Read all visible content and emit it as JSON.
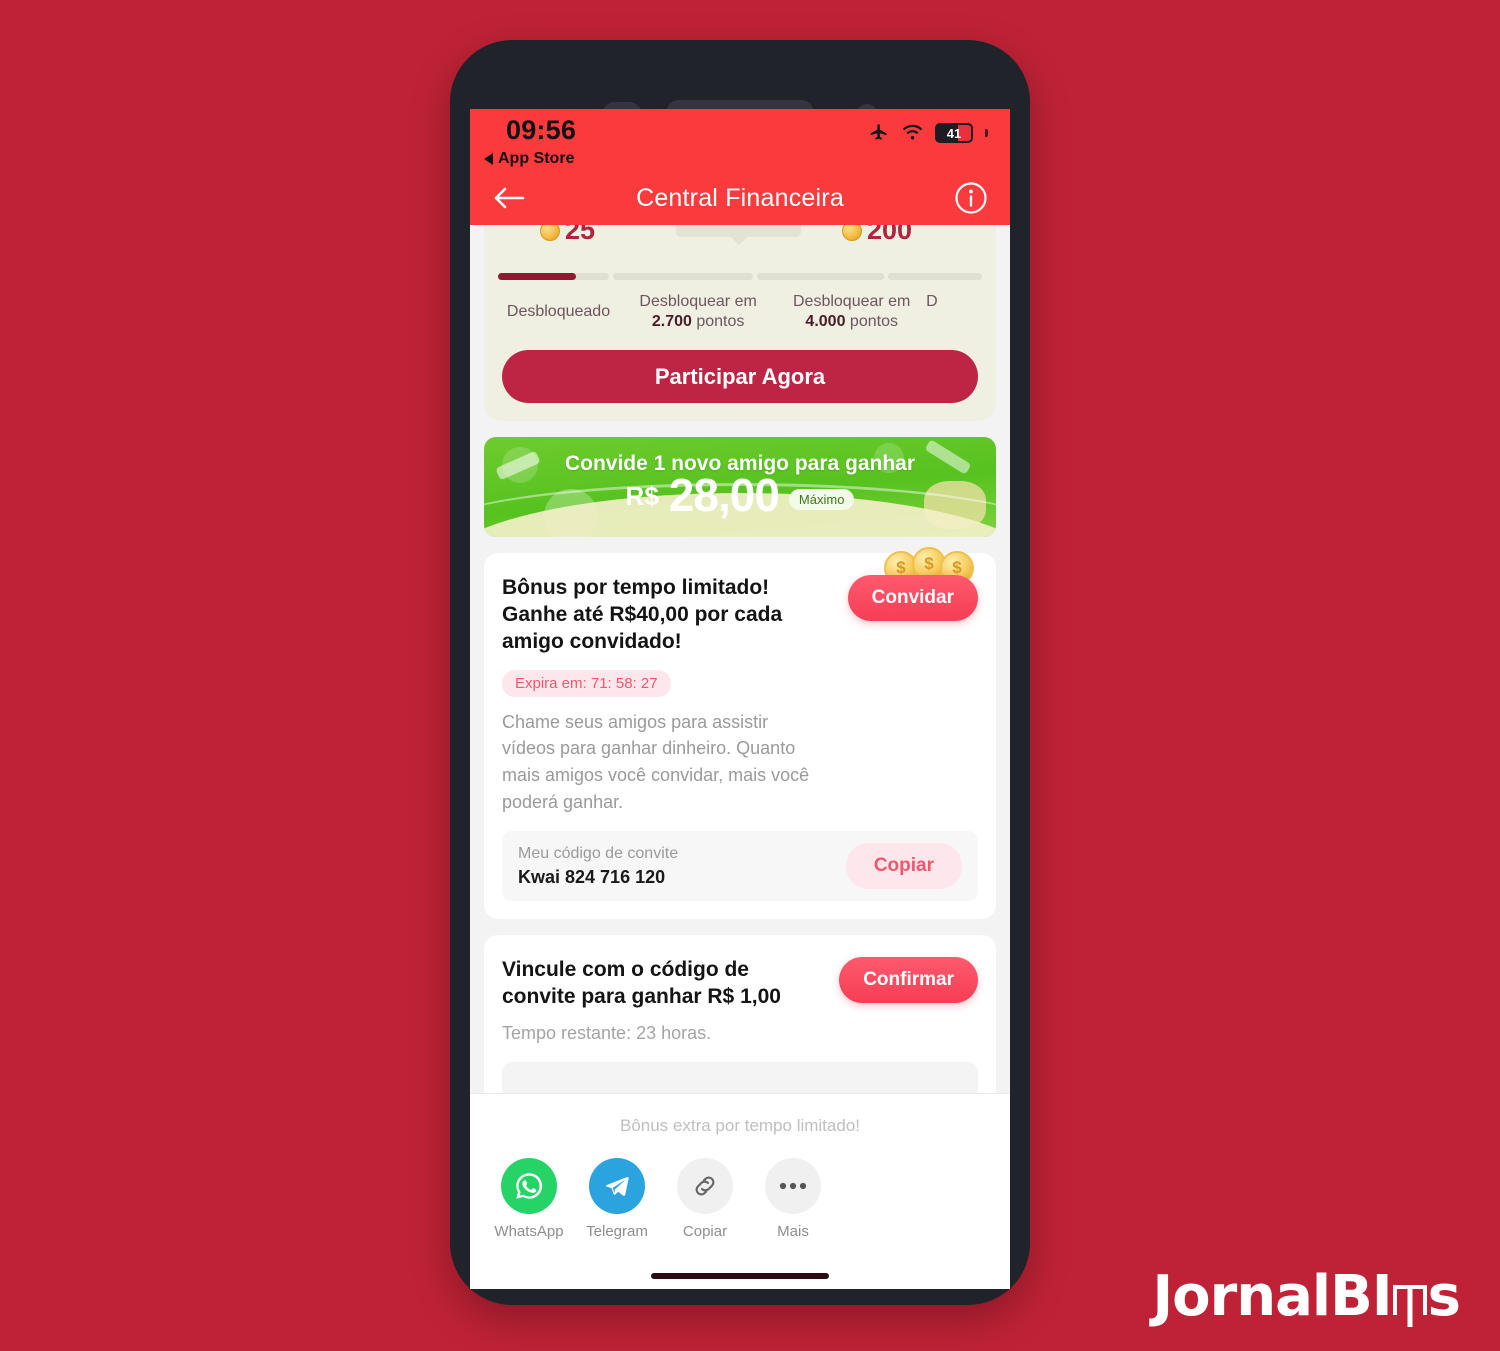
{
  "background_color": "#BF2236",
  "phone": {
    "frame_color": "#20232a"
  },
  "status_bar": {
    "time": "09:56",
    "back_app_label": "App Store",
    "icons": [
      "airplane-icon",
      "wifi-icon",
      "battery-icon"
    ],
    "battery_percent": "41"
  },
  "nav_bar": {
    "back_icon": "arrow-left-icon",
    "title": "Central Financeira",
    "info_icon": "info-circle-icon",
    "bg_color": "#FB3A3E"
  },
  "milestone_card": {
    "coins": [
      {
        "value": "25"
      },
      {
        "value": "200"
      }
    ],
    "steps": [
      {
        "label_line1": "Desbloqueado",
        "label_line2": ""
      },
      {
        "label_line1": "Desbloquear em",
        "points": "2.700",
        "label_line2": "pontos"
      },
      {
        "label_line1": "Desbloquear em",
        "points": "4.000",
        "label_line2": "pontos"
      },
      {
        "label_line1": "D",
        "label_line2": ""
      }
    ],
    "cta_label": "Participar Agora",
    "cta_color": "#BE2544",
    "bg_color": "#EFEFE2"
  },
  "green_banner": {
    "title": "Convide 1 novo amigo para ganhar",
    "currency": "R$",
    "amount": "28,00",
    "max_badge": "Máximo",
    "bg_color": "#56C21F"
  },
  "bonus_card": {
    "title": "Bônus por tempo limitado! Ganhe até R$40,00 por cada amigo convidado!",
    "invite_button": "Convidar",
    "expire_badge": "Expira em: 71: 58: 27",
    "description": "Chame seus amigos para assistir vídeos para ganhar dinheiro. Quanto mais amigos você convidar, mais você poderá ganhar.",
    "code_label": "Meu código de convite",
    "code_value": "Kwai 824 716 120",
    "copy_button": "Copiar"
  },
  "link_card": {
    "title": "Vincule com o código de convite para ganhar R$ 1,00",
    "confirm_button": "Confirmar",
    "subtitle": "Tempo restante: 23 horas."
  },
  "share_sheet": {
    "title": "Bônus extra por tempo limitado!",
    "items": [
      {
        "label": "WhatsApp",
        "icon": "whatsapp-icon"
      },
      {
        "label": "Telegram",
        "icon": "telegram-icon"
      },
      {
        "label": "Copiar",
        "icon": "link-icon"
      },
      {
        "label": "Mais",
        "icon": "ellipsis-icon"
      }
    ]
  },
  "watermark": {
    "part1": "Jornal",
    "part2": "BI",
    "part3": "s"
  }
}
